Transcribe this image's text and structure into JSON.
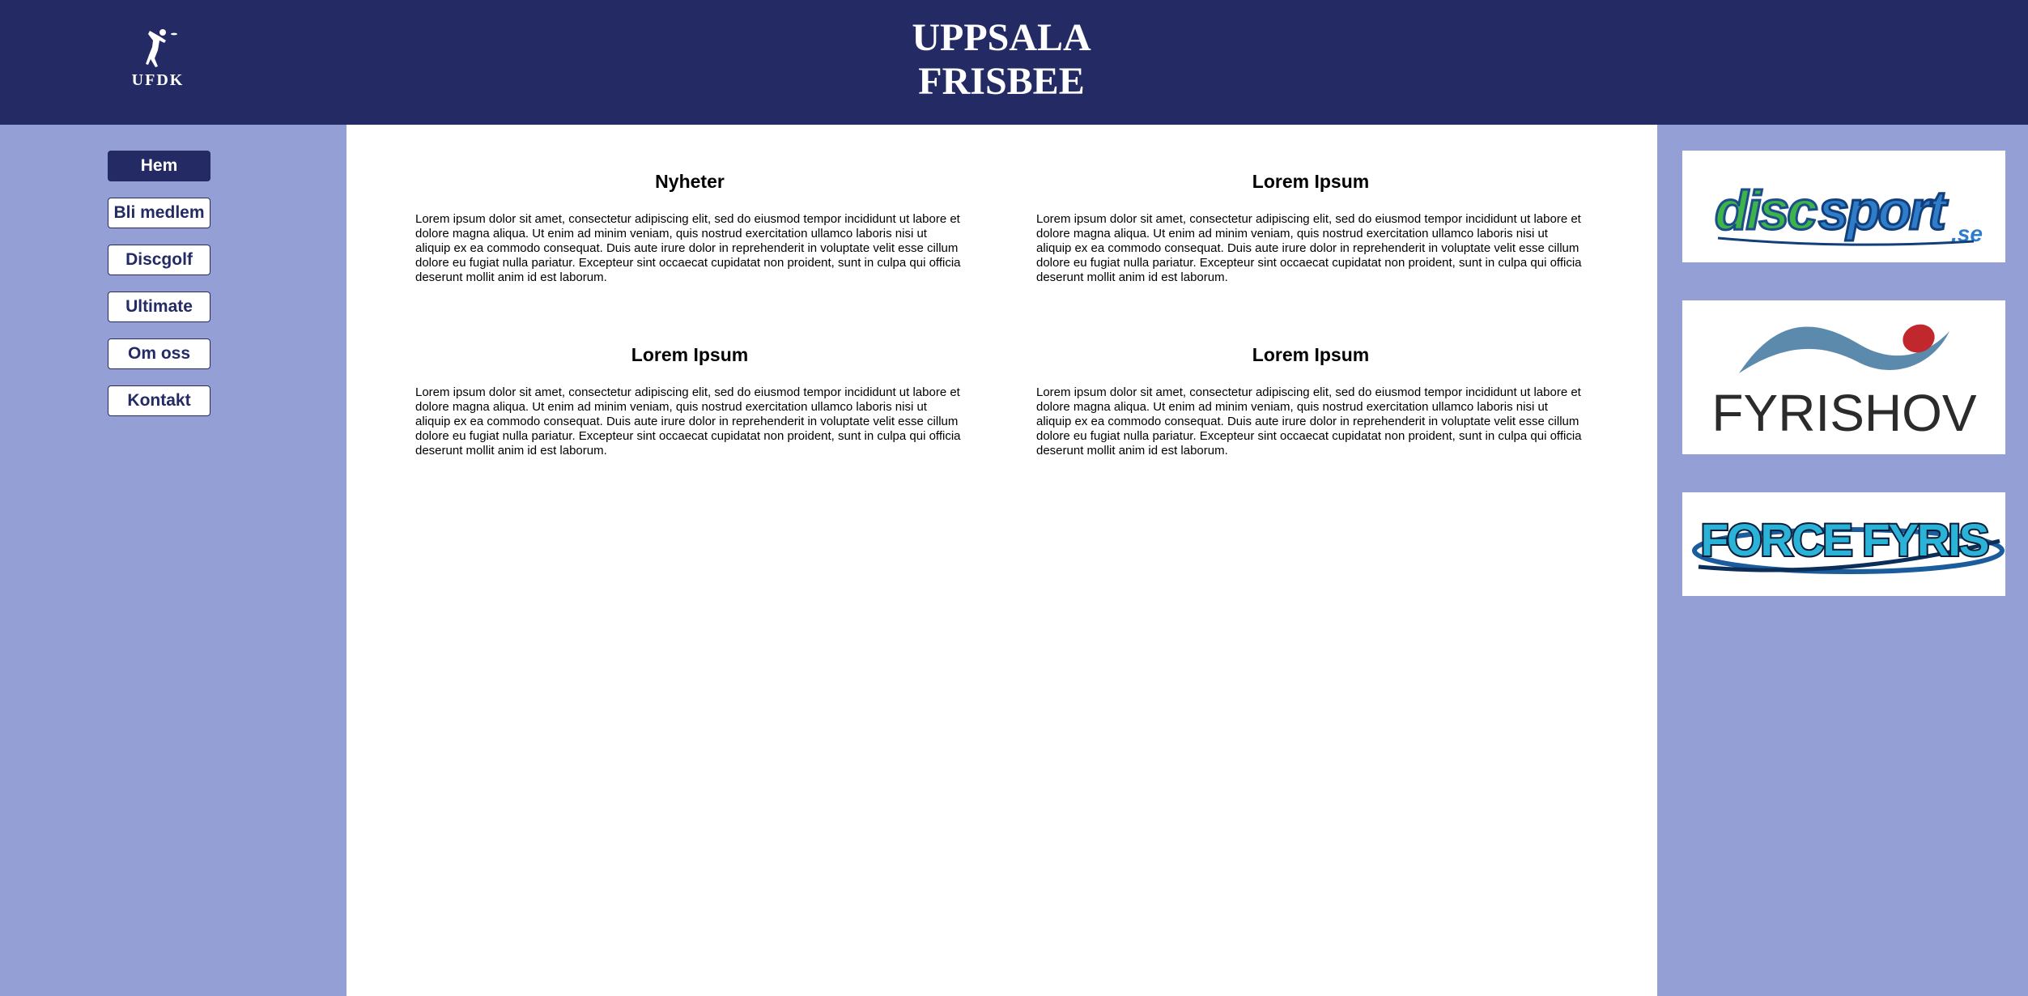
{
  "header": {
    "logo_text": "UFDK",
    "title_line1": "UPPSALA",
    "title_line2": "FRISBEE"
  },
  "nav": {
    "items": [
      {
        "label": "Hem",
        "active": true
      },
      {
        "label": "Bli medlem",
        "active": false
      },
      {
        "label": "Discgolf",
        "active": false
      },
      {
        "label": "Ultimate",
        "active": false
      },
      {
        "label": "Om oss",
        "active": false
      },
      {
        "label": "Kontakt",
        "active": false
      }
    ]
  },
  "articles": [
    {
      "title": "Nyheter",
      "body": "Lorem ipsum dolor sit amet, consectetur adipiscing elit, sed do eiusmod tempor incididunt ut labore et dolore magna aliqua. Ut enim ad minim veniam, quis nostrud exercitation ullamco laboris nisi ut aliquip ex ea commodo consequat. Duis aute irure dolor in reprehenderit in voluptate velit esse cillum dolore eu fugiat nulla pariatur. Excepteur sint occaecat cupidatat non proident, sunt in culpa qui officia deserunt mollit anim id est laborum."
    },
    {
      "title": "Lorem Ipsum",
      "body": "Lorem ipsum dolor sit amet, consectetur adipiscing elit, sed do eiusmod tempor incididunt ut labore et dolore magna aliqua. Ut enim ad minim veniam, quis nostrud exercitation ullamco laboris nisi ut aliquip ex ea commodo consequat. Duis aute irure dolor in reprehenderit in voluptate velit esse cillum dolore eu fugiat nulla pariatur. Excepteur sint occaecat cupidatat non proident, sunt in culpa qui officia deserunt mollit anim id est laborum."
    },
    {
      "title": "Lorem Ipsum",
      "body": "Lorem ipsum dolor sit amet, consectetur adipiscing elit, sed do eiusmod tempor incididunt ut labore et dolore magna aliqua. Ut enim ad minim veniam, quis nostrud exercitation ullamco laboris nisi ut aliquip ex ea commodo consequat. Duis aute irure dolor in reprehenderit in voluptate velit esse cillum dolore eu fugiat nulla pariatur. Excepteur sint occaecat cupidatat non proident, sunt in culpa qui officia deserunt mollit anim id est laborum."
    },
    {
      "title": "Lorem Ipsum",
      "body": "Lorem ipsum dolor sit amet, consectetur adipiscing elit, sed do eiusmod tempor incididunt ut labore et dolore magna aliqua. Ut enim ad minim veniam, quis nostrud exercitation ullamco laboris nisi ut aliquip ex ea commodo consequat. Duis aute irure dolor in reprehenderit in voluptate velit esse cillum dolore eu fugiat nulla pariatur. Excepteur sint occaecat cupidatat non proident, sunt in culpa qui officia deserunt mollit anim id est laborum."
    }
  ],
  "sponsors": [
    {
      "name": "discsport.se",
      "logo_part1": "disc",
      "logo_part2": "sport",
      "logo_part3": ".se"
    },
    {
      "name": "FYRISHOV",
      "logo_text": "FYRISHOV"
    },
    {
      "name": "FORCE FYRIS",
      "logo_text": "FORCE FYRIS"
    }
  ],
  "colors": {
    "header_bg": "#232a64",
    "sidebar_bg": "#939fd5",
    "main_bg": "#ffffff",
    "nav_active_bg": "#232a64"
  }
}
